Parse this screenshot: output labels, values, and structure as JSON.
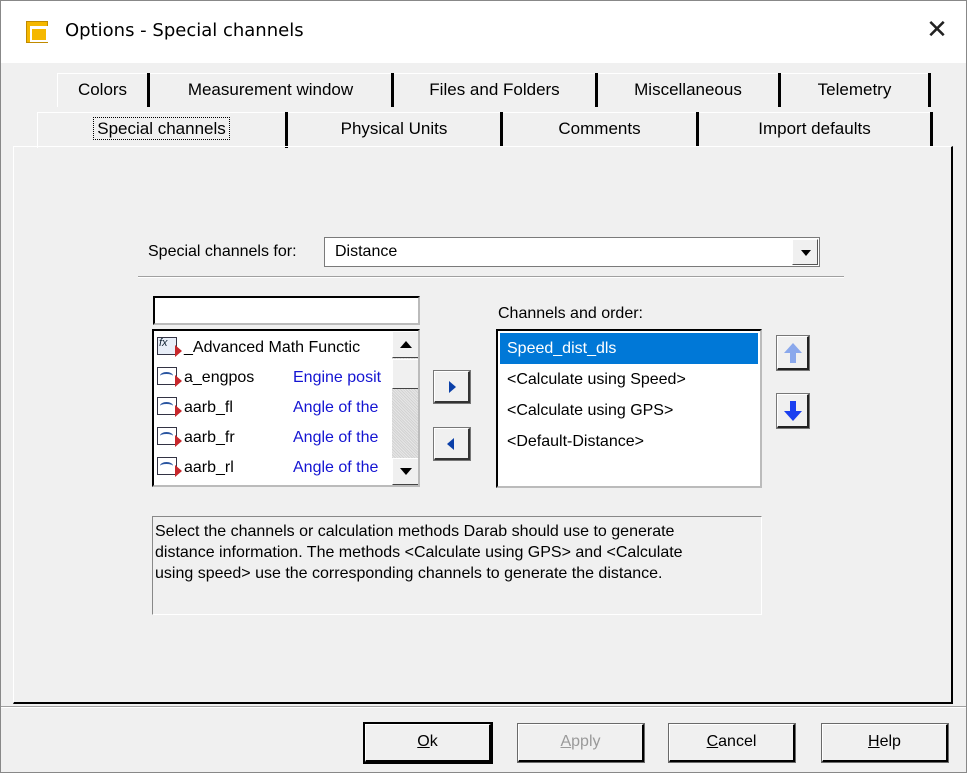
{
  "window": {
    "title": "Options - Special channels",
    "close_glyph": "✕"
  },
  "tabs": {
    "row1": [
      "Colors",
      "Measurement window",
      "Files and Folders",
      "Miscellaneous",
      "Telemetry"
    ],
    "row2": [
      "Special channels",
      "Physical Units",
      "Comments",
      "Import defaults"
    ],
    "active": "Special channels"
  },
  "special": {
    "label": "Special channels for:",
    "selected": "Distance"
  },
  "filter": {
    "value": ""
  },
  "channels": [
    {
      "icon": "function-channel-icon",
      "name": "_Advanced Math Functic",
      "desc": ""
    },
    {
      "icon": "signal-channel-icon",
      "name": "a_engpos",
      "desc": "Engine posit"
    },
    {
      "icon": "signal-channel-icon",
      "name": "aarb_fl",
      "desc": "Angle of the"
    },
    {
      "icon": "signal-channel-icon",
      "name": "aarb_fr",
      "desc": "Angle of the"
    },
    {
      "icon": "signal-channel-icon",
      "name": "aarb_rl",
      "desc": "Angle of the"
    }
  ],
  "order": {
    "label": "Channels and order:",
    "items": [
      "Speed_dist_dls",
      "<Calculate using Speed>",
      "<Calculate using GPS>",
      "<Default-Distance>"
    ],
    "selected_index": 0
  },
  "help_text": {
    "line1": "Select the channels or calculation methods Darab should use to generate",
    "line2": "distance information. The methods <Calculate using GPS> and <Calculate",
    "line3": "using speed> use the corresponding channels to generate the distance."
  },
  "buttons": {
    "ok": {
      "accel": "O",
      "rest": "k"
    },
    "apply": {
      "accel": "A",
      "rest": "pply"
    },
    "cancel": {
      "accel": "C",
      "rest": "ancel"
    },
    "help": {
      "accel": "H",
      "rest": "elp"
    }
  },
  "colors": {
    "selection": "#0078d7",
    "description_text": "#1414d2",
    "app_icon": "#f5b800"
  }
}
